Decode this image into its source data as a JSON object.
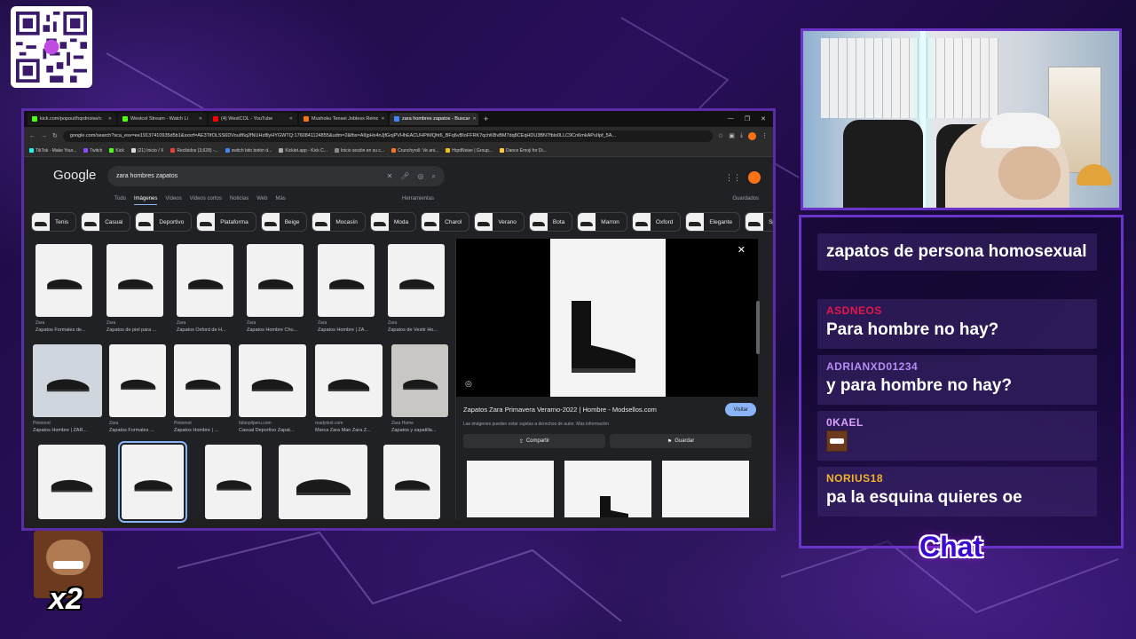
{
  "browser": {
    "tabs": [
      {
        "label": "kick.com/popout/hqrdnoise/c",
        "color": "#53fc18",
        "active": false
      },
      {
        "label": "Westcol Stream - Watch Li",
        "color": "#53fc18",
        "active": false
      },
      {
        "label": "(4) WestCOL - YouTube",
        "color": "#ff0000",
        "active": false
      },
      {
        "label": "Mushoku Tensei Jobless Reinc",
        "color": "#f47521",
        "active": false
      },
      {
        "label": "zara hombres zapatos - Buscar",
        "color": "#4285f4",
        "active": true
      }
    ],
    "url": "google.com/search?sca_esv=ee19137410935d5b1&sxsrf=AE3TifOLSS6DVouIf6q2fNUHz8lyHYGWTQ:1760841124855&udm=2&fbs=AIIjpHx4nJjfGojPVHhEACUHPiMQht6_BFq6vBIoFFRK7qchKBvBM7dq8CEqHDU3BN7fblo0LLC9Cn6mkAPuIIpf_5A...",
    "bookmarks": [
      "TikTok - Make Your...",
      "Twitch",
      "Kick",
      "(21) Inicio / X",
      "Recibidos (3,628) -...",
      "switch bito botón d...",
      "Kicklet.app - Kick C...",
      "Inicio sesión en su c...",
      "Crunchyroll: Ve ani...",
      "HqrdNoise | Group...",
      "Dance Emoji for Di..."
    ]
  },
  "google": {
    "logo": "Google",
    "query": "zara hombres zapatos",
    "tabs": [
      "Todo",
      "Imágenes",
      "Videos",
      "Videos cortos",
      "Noticias",
      "Web",
      "Más"
    ],
    "active_tab": "Imágenes",
    "tools": "Herramientas",
    "saved": "Guardados",
    "chips": [
      "Tenis",
      "Casual",
      "Deportivo",
      "Plataforma",
      "Beige",
      "Mocasín",
      "Moda",
      "Charol",
      "Verano",
      "Bota",
      "Marron",
      "Oxford",
      "Elegante",
      "Sport"
    ],
    "results_row1": [
      {
        "source": "Zara",
        "title": "Zapatos Formales de..."
      },
      {
        "source": "Zara",
        "title": "Zapatos de piel para ..."
      },
      {
        "source": "Zara",
        "title": "Zapatos Oxford de H..."
      },
      {
        "source": "Zara",
        "title": "Zapatos Hombre Chu..."
      },
      {
        "source": "Zara",
        "title": "Zapatos Hombre | ZA..."
      },
      {
        "source": "Zara",
        "title": "Zapatos de Vestir Ho..."
      }
    ],
    "results_row2": [
      {
        "source": "Pinterest",
        "title": "Zapatos Hombre | ZAR..."
      },
      {
        "source": "Zara",
        "title": "Zapatos Formales ..."
      },
      {
        "source": "Pinterest",
        "title": "Zapatos Hombre | ..."
      },
      {
        "source": "fabiopilperu.com",
        "title": "Casual Deportivo Zapat..."
      },
      {
        "source": "readytext.com",
        "title": "Marca Zara Man Zara Z..."
      },
      {
        "source": "Zara Home",
        "title": "Zapatos y zapatilla..."
      }
    ],
    "panel": {
      "title": "Zapatos Zara Primavera Verarno-2022 | Hombre - Modsellos.com",
      "visit": "Visitar",
      "note": "Las imágenes pueden estar sujetas a derechos de autor. Más información",
      "share": "Compartir",
      "save": "Guardar"
    }
  },
  "chat": {
    "title": "Chat",
    "messages": [
      {
        "user": "",
        "user_color": "#ffffff",
        "text": "zapatos de persona homosexual"
      },
      {
        "user": "ASDNEOS",
        "user_color": "#e5174a",
        "text": "Para hombre no hay?"
      },
      {
        "user": "ADRIANXD01234",
        "user_color": "#b58cf5",
        "text": "y para hombre no hay?"
      },
      {
        "user": "0KAEL",
        "user_color": "#d8a0ff",
        "text": ""
      },
      {
        "user": "NORIUS18",
        "user_color": "#f0b428",
        "text": "pa la esquina quieres oe"
      }
    ]
  },
  "overlay": {
    "multiplier": "x2"
  }
}
